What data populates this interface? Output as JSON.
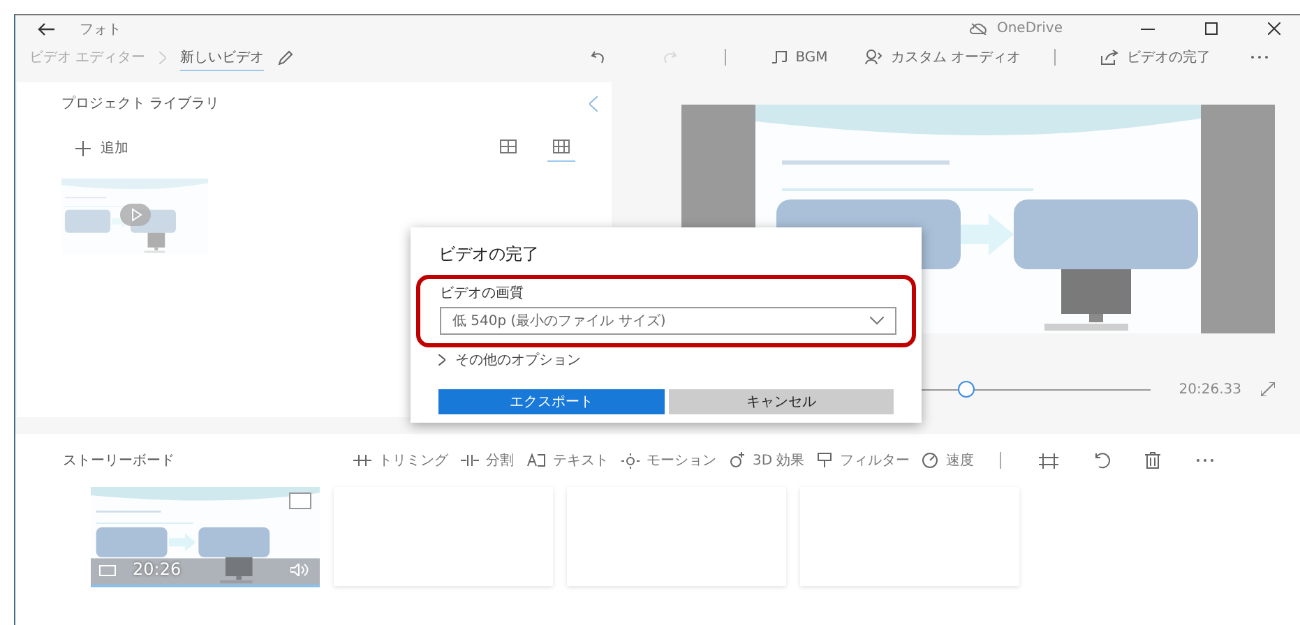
{
  "window": {
    "app_title": "フォト",
    "cloud_label": "OneDrive"
  },
  "breadcrumb": [
    {
      "label": "ビデオ エディター",
      "selected": false
    },
    {
      "label": "新しいビデオ",
      "selected": true
    }
  ],
  "toolbar": [
    {
      "kind": "undo",
      "disabled": false
    },
    {
      "kind": "redo",
      "disabled": true
    },
    {
      "kind": "separator"
    },
    {
      "kind": "music",
      "label": "BGM"
    },
    {
      "kind": "voice",
      "label": "カスタム オーディオ"
    },
    {
      "kind": "separator"
    },
    {
      "kind": "share",
      "label": "ビデオの完了"
    },
    {
      "kind": "more"
    }
  ],
  "library": {
    "title": "プロジェクト ライブラリ",
    "add_label": "追加",
    "views": [
      {
        "kind": "large",
        "selected": false
      },
      {
        "kind": "small",
        "selected": true
      }
    ]
  },
  "preview": {
    "kind": "picture",
    "level": 0.45,
    "duration": "20:26.33"
  },
  "dialog": {
    "title": "ビデオの完了",
    "quality_label": "ビデオの画質",
    "quality_value": "低 540p (最小のファイル サイズ)",
    "more_options": "その他のオプション",
    "expanded": false,
    "buttons": [
      {
        "kind": "primary",
        "label": "エクスポート"
      },
      {
        "kind": "secondary",
        "label": "キャンセル"
      }
    ]
  },
  "storyboard": {
    "title": "ストーリーボード",
    "tools": [
      {
        "kind": "trim",
        "label": "トリミング"
      },
      {
        "kind": "split",
        "label": "分割"
      },
      {
        "kind": "text",
        "label": "テキスト"
      },
      {
        "kind": "motion",
        "label": "モーション"
      },
      {
        "kind": "effects",
        "label": "3D 効果"
      },
      {
        "kind": "filter",
        "label": "フィルター"
      },
      {
        "kind": "speed",
        "label": "速度"
      },
      {
        "kind": "separator"
      },
      {
        "kind": "resize"
      },
      {
        "kind": "rotate"
      },
      {
        "kind": "delete"
      },
      {
        "kind": "more"
      }
    ],
    "cards": [
      {
        "kind": "clip",
        "duration": "20:26",
        "selected": true,
        "checked": false
      },
      {
        "kind": "empty"
      },
      {
        "kind": "empty"
      },
      {
        "kind": "empty"
      }
    ]
  }
}
